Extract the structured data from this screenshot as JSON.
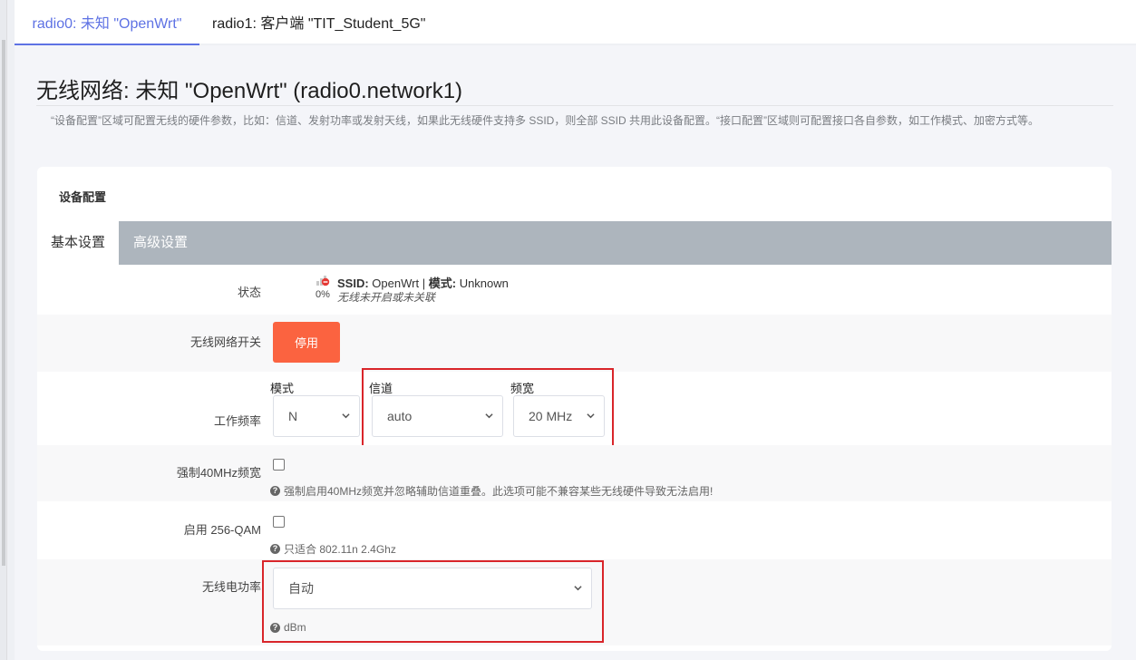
{
  "top_tabs": [
    {
      "label": "radio0: 未知 \"OpenWrt\"",
      "active": true
    },
    {
      "label": "radio1: 客户端 \"TIT_Student_5G\"",
      "active": false
    }
  ],
  "page": {
    "title": "无线网络: 未知 \"OpenWrt\" (radio0.network1)",
    "description": "“设备配置”区域可配置无线的硬件参数，比如：信道、发射功率或发射天线，如果此无线硬件支持多 SSID，则全部 SSID 共用此设备配置。“接口配置”区域则可配置接口各自参数，如工作模式、加密方式等。"
  },
  "panel": {
    "header": "设备配置",
    "tabs": [
      {
        "label": "基本设置",
        "active": true
      },
      {
        "label": "高级设置",
        "active": false
      }
    ]
  },
  "status": {
    "label": "状态",
    "percent": "0%",
    "ssid_key": "SSID:",
    "ssid_value": "OpenWrt",
    "sep": "|",
    "mode_key": "模式:",
    "mode_value": "Unknown",
    "note": "无线未开启或未关联"
  },
  "wireless_toggle": {
    "label": "无线网络开关",
    "button": "停用"
  },
  "frequency": {
    "label": "工作频率",
    "mode_label": "模式",
    "mode_value": "N",
    "channel_label": "信道",
    "channel_value": "auto",
    "width_label": "频宽",
    "width_value": "20 MHz"
  },
  "force40": {
    "label": "强制40MHz频宽",
    "help": "强制启用40MHz频宽并忽略辅助信道重叠。此选项可能不兼容某些无线硬件导致无法启用!"
  },
  "qam": {
    "label": "启用 256-QAM",
    "help": "只适合 802.11n 2.4Ghz"
  },
  "txpower": {
    "label": "无线电功率",
    "value": "自动",
    "help": "dBm"
  },
  "colors": {
    "accent": "#5e72e4",
    "danger_button": "#fb6340",
    "tabbar": "#adb5bd",
    "highlight": "#d9252a"
  },
  "icons": {
    "status": "signal-none-icon",
    "help": "question-circle-icon",
    "chevron": "chevron-down-icon"
  }
}
